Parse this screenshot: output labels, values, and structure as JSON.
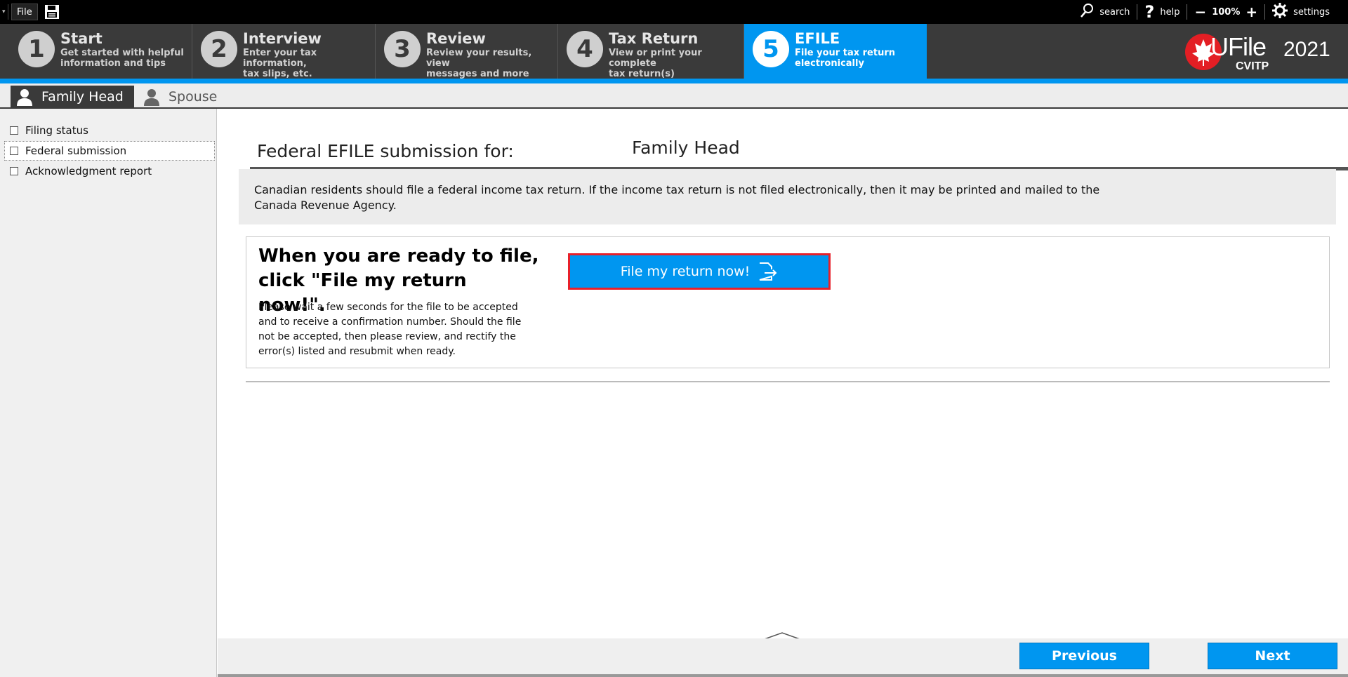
{
  "topbar": {
    "file_label": "File",
    "search_label": "search",
    "help_label": "help",
    "zoom_minus": "−",
    "zoom_value": "100%",
    "zoom_plus": "+",
    "settings_label": "settings"
  },
  "steps": [
    {
      "num": "1",
      "title": "Start",
      "sub": "Get started with helpful\ninformation and tips"
    },
    {
      "num": "2",
      "title": "Interview",
      "sub": "Enter your tax information,\ntax slips, etc."
    },
    {
      "num": "3",
      "title": "Review",
      "sub": "Review your results, view\nmessages and more"
    },
    {
      "num": "4",
      "title": "Tax Return",
      "sub": "View or print your complete\ntax return(s)"
    },
    {
      "num": "5",
      "title": "EFILE",
      "sub": "File your tax return\nelectronically"
    }
  ],
  "logo": {
    "brand": "UFile",
    "year": "2021",
    "sub": "CVITP"
  },
  "person_tabs": {
    "active": "Family Head",
    "inactive": "Spouse"
  },
  "sidebar": {
    "items": [
      {
        "label": "Filing status"
      },
      {
        "label": "Federal submission"
      },
      {
        "label": "Acknowledgment report"
      }
    ]
  },
  "main": {
    "title_label": "Federal EFILE submission for:",
    "title_person": "Family Head",
    "info_text": "Canadian residents should file a federal income tax return. If the income tax return is not filed electronically, then it may be printed and mailed to the Canada Revenue Agency.",
    "file_heading": "When you are ready to file,\nclick \"File my return now!\".",
    "file_note": "Please wait a few seconds for the file to be accepted and to receive a confirmation number. Should the file not be accepted, then please review, and rectify the error(s) listed and resubmit when ready.",
    "file_button": "File my return now!"
  },
  "footer": {
    "previous": "Previous",
    "next": "Next"
  },
  "colors": {
    "accent": "#0096f0",
    "highlight_border": "#e8202a",
    "dark_bar": "#3a3a3a"
  }
}
